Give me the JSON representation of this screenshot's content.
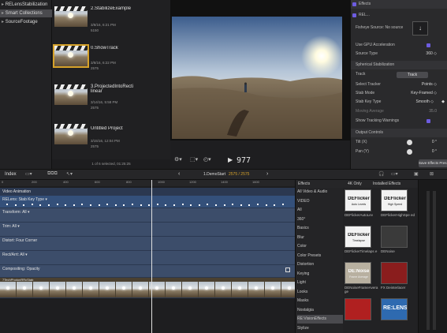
{
  "library": {
    "items": [
      {
        "label": "RELensStabilization"
      },
      {
        "label": "Smart Collections"
      },
      {
        "label": "SourceFootage"
      }
    ]
  },
  "browser": {
    "clips": [
      {
        "name": "2.StabilizeExample",
        "date": "3/8/16, 6:21 PM",
        "frames": "5150"
      },
      {
        "name": "0.ShowTrack",
        "date": "3/8/16, 6:22 PM",
        "frames": "2575"
      },
      {
        "name": "3.ProjectedIntoRecti linear",
        "date": "3/14/16, 5:58 PM",
        "frames": "2575"
      },
      {
        "name": "Untitled Project",
        "date": "3/15/16, 12:04 PM",
        "frames": "2575"
      }
    ],
    "status": "1 of 6 selected, 01:25:25"
  },
  "viewer": {
    "timecode": "977"
  },
  "inspector": {
    "effects_header": "Effects",
    "effect_name": "REL...",
    "fisheye_label": "Fisheye Source: No source",
    "gpu_label": "Use GPU Acceleration",
    "source_type_label": "Source Type",
    "source_type_value": "360 ◇",
    "spherical_header": "Spherical Stabilization",
    "track_label": "Track",
    "track_button": "Track",
    "select_tracker_label": "Select Tracker",
    "select_tracker_value": "Points ◇",
    "stab_mode_label": "Stab Mode",
    "stab_mode_value": "Key-Framed ◇",
    "stab_key_type_label": "Stab Key Type",
    "stab_key_type_value": "Smooth ◇",
    "moving_avg_label": "Moving Average",
    "moving_avg_value": "35.0",
    "show_warnings_label": "Show Tracking Warnings",
    "output_header": "Output Controls",
    "tilt_label": "Tilt (X)",
    "tilt_value": "0 °",
    "pan_label": "Pan (Y)",
    "pan_value": "0 °",
    "save_preset": "Save Effects Pres..."
  },
  "toolbar": {
    "index_label": "Index",
    "project_name": "1.DemoStart",
    "project_frames": "2575 / 2575"
  },
  "timeline": {
    "ruler": [
      "0",
      "200",
      "400",
      "600",
      "800",
      "1000",
      "1200",
      "1400",
      "1600"
    ],
    "lanes": [
      {
        "label": "Video Animation"
      },
      {
        "label": "RELens: Stab Key Type ▾"
      },
      {
        "label": "Transform: All ▾"
      },
      {
        "label": "Trim: All ▾"
      },
      {
        "label": "Distort: Four Corner"
      },
      {
        "label": "Rect/Arrt: All ▾"
      },
      {
        "label": "Compositing: Opacity"
      }
    ],
    "clip_label": "7TechPhotonRRcStab"
  },
  "effects": {
    "header": "Effects",
    "filter_4k": "4K Only",
    "installed": "Installed Effects",
    "categories": [
      "All Video & Audio",
      "VIDEO",
      "All",
      "360°",
      "Basics",
      "Blur",
      "Color",
      "Color Presets",
      "Distortion",
      "Keying",
      "Light",
      "Looks",
      "Masks",
      "Nostalgia",
      "RE:VisionEffects",
      "Stylize"
    ],
    "selected_category": "RE:VisionEffects",
    "tiles": [
      {
        "name": "DEFlickerAutoLev",
        "line1": "DEFlicker",
        "line2": "Auto Levels"
      },
      {
        "name": "DEFlickerHighSpe ed",
        "line1": "DEFlicker",
        "line2": "High Speed"
      },
      {
        "name": "DEFlickerTimelaps e",
        "line1": "DEFlicker",
        "line2": "Timelapse"
      },
      {
        "name": "DENoise",
        "line1": "",
        "line2": ""
      },
      {
        "name": "DENoiseFrameAvera ge",
        "line1": "DE:Noise",
        "line2": "Frame Average"
      },
      {
        "name": "FX Deinterlacer",
        "line1": "",
        "line2": ""
      },
      {
        "name": "",
        "line1": "",
        "line2": ""
      },
      {
        "name": "",
        "line1": "RE:LENS",
        "line2": ""
      }
    ]
  }
}
